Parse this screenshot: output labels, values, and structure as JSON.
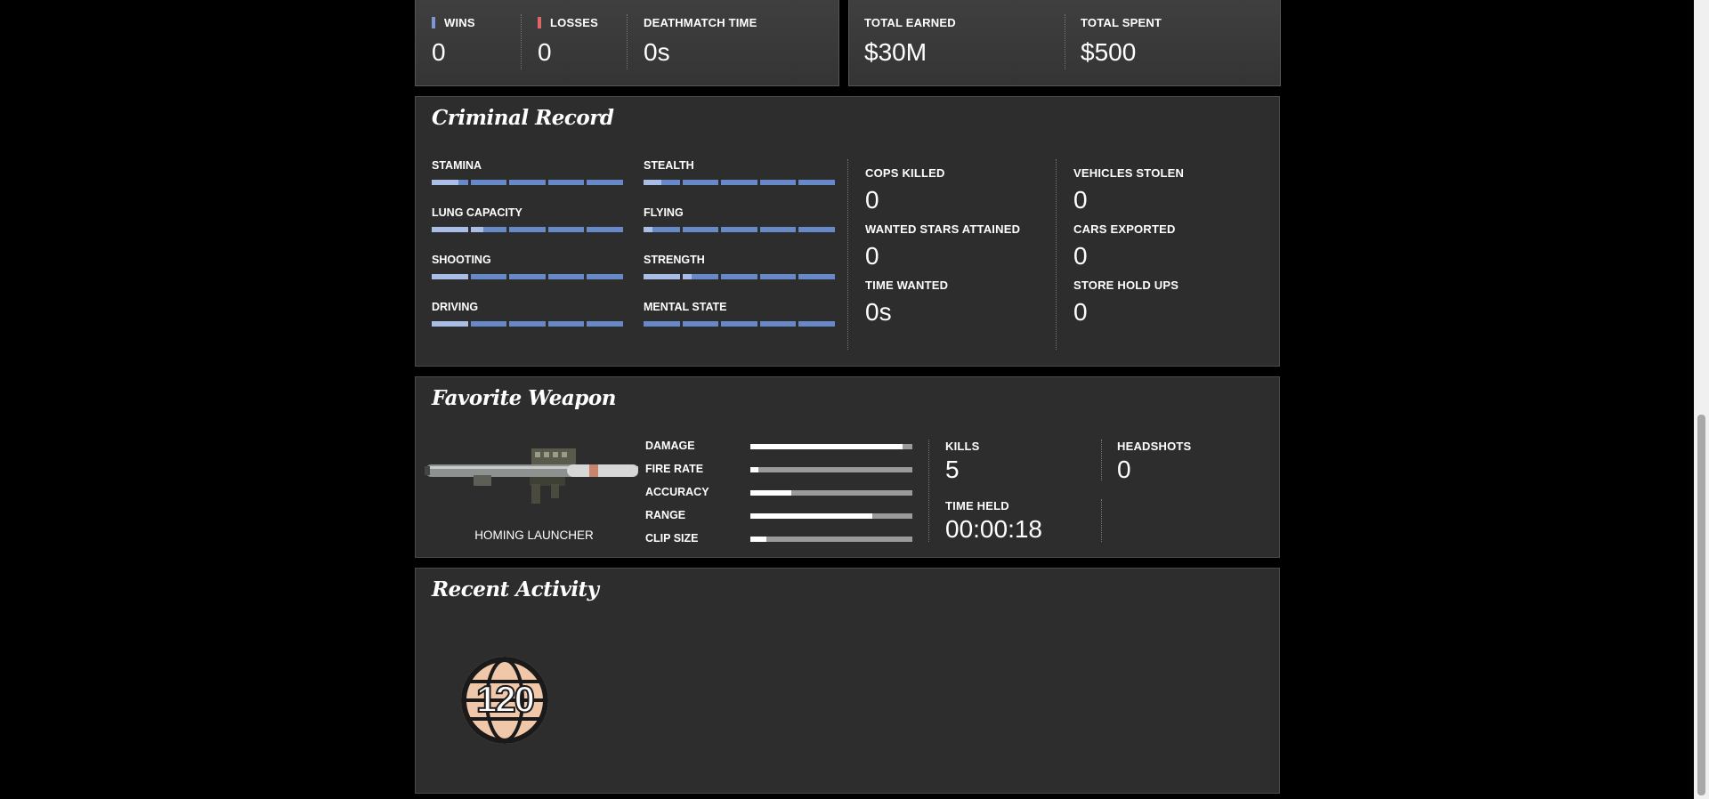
{
  "top_left": {
    "wins_label": "WINS",
    "wins_value": "0",
    "losses_label": "LOSSES",
    "losses_value": "0",
    "deathmatch_label": "DEATHMATCH TIME",
    "deathmatch_value": "0s",
    "wins_color": "#7f95d6",
    "losses_color": "#e06666"
  },
  "top_right": {
    "earned_label": "TOTAL EARNED",
    "earned_value": "$30M",
    "spent_label": "TOTAL SPENT",
    "spent_value": "$500"
  },
  "criminal": {
    "title": "Criminal Record",
    "skills": [
      {
        "label": "STAMINA",
        "level": 0.15
      },
      {
        "label": "STEALTH",
        "level": 0.1
      },
      {
        "label": "LUNG CAPACITY",
        "level": 0.27
      },
      {
        "label": "FLYING",
        "level": 0.05
      },
      {
        "label": "SHOOTING",
        "level": 0.2
      },
      {
        "label": "STRENGTH",
        "level": 0.25
      },
      {
        "label": "DRIVING",
        "level": 0.2
      },
      {
        "label": "MENTAL STATE",
        "level": 0.0
      }
    ],
    "stats": {
      "cops_killed_label": "COPS KILLED",
      "cops_killed_value": "0",
      "wanted_stars_label": "WANTED STARS ATTAINED",
      "wanted_stars_value": "0",
      "time_wanted_label": "TIME WANTED",
      "time_wanted_value": "0s",
      "vehicles_stolen_label": "VEHICLES STOLEN",
      "vehicles_stolen_value": "0",
      "cars_exported_label": "CARS EXPORTED",
      "cars_exported_value": "0",
      "store_holdups_label": "STORE HOLD UPS",
      "store_holdups_value": "0"
    },
    "bar_color": "#6789c8",
    "bar_fill_color": "#a9bde6"
  },
  "weapon": {
    "title": "Favorite Weapon",
    "name": "HOMING LAUNCHER",
    "image_icon": "rocket-launcher-icon",
    "attributes": [
      {
        "label": "DAMAGE",
        "level": 0.94
      },
      {
        "label": "FIRE RATE",
        "level": 0.05
      },
      {
        "label": "ACCURACY",
        "level": 0.25
      },
      {
        "label": "RANGE",
        "level": 0.75
      },
      {
        "label": "CLIP SIZE",
        "level": 0.1
      }
    ],
    "kills_label": "KILLS",
    "kills_value": "5",
    "headshots_label": "HEADSHOTS",
    "headshots_value": "0",
    "time_held_label": "TIME HELD",
    "time_held_value": "00:00:18"
  },
  "recent": {
    "title": "Recent Activity",
    "rank_badge": "120",
    "badge_icon": "globe-rank-icon"
  }
}
